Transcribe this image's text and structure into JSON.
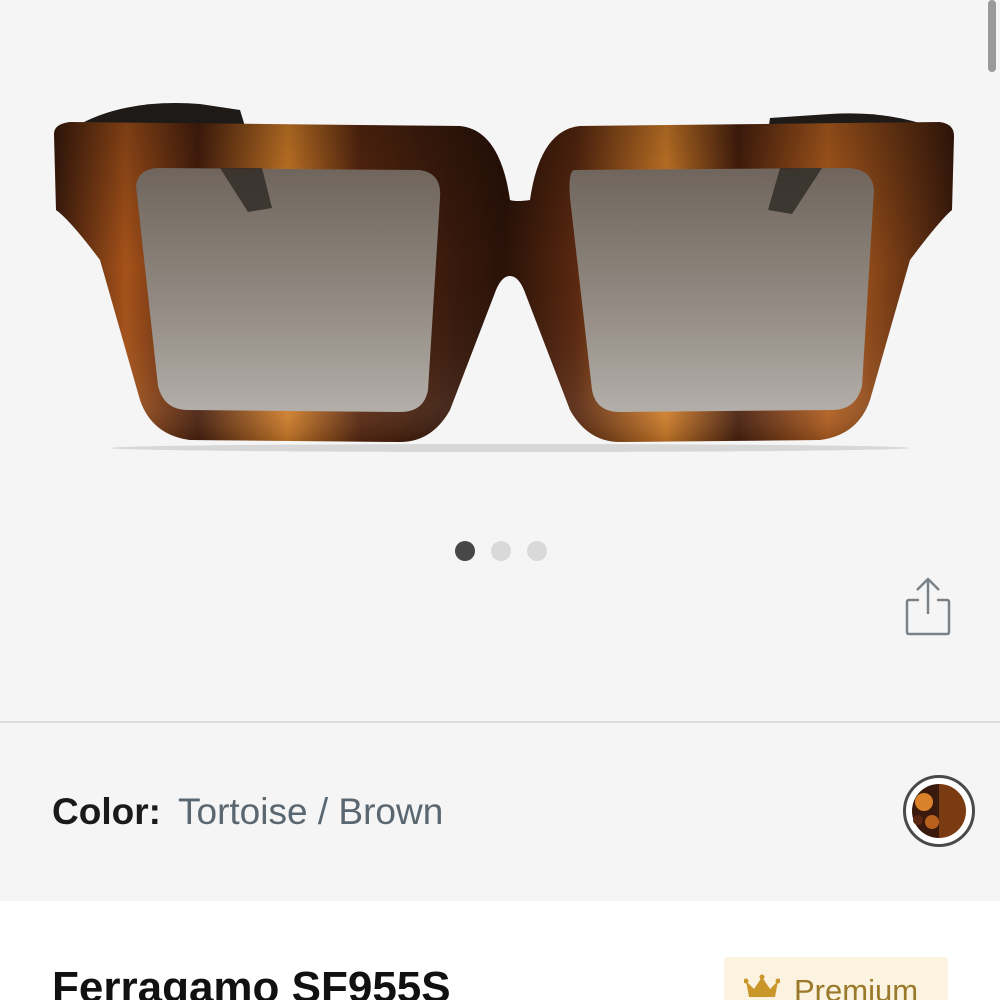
{
  "gallery": {
    "image_alt": "Tortoise / Brown square sunglasses",
    "slides_total": 3,
    "active_slide": 1
  },
  "color": {
    "label": "Color:",
    "value": "Tortoise / Brown"
  },
  "product": {
    "name": "Ferragamo SF955S",
    "badge": "Premium"
  },
  "colors": {
    "tortoise_dark": "#3a1a0c",
    "tortoise_mid": "#7a3a12",
    "tortoise_light": "#d9822a",
    "lens": "#8a8178",
    "premium_bg": "#fbf3df",
    "premium_text": "#9a7a2a",
    "dot_active": "#474747",
    "dot_inactive": "#d9d9d9"
  },
  "icons": {
    "share": "share-icon",
    "crown": "crown-icon",
    "swatch": "color-swatch-icon"
  }
}
